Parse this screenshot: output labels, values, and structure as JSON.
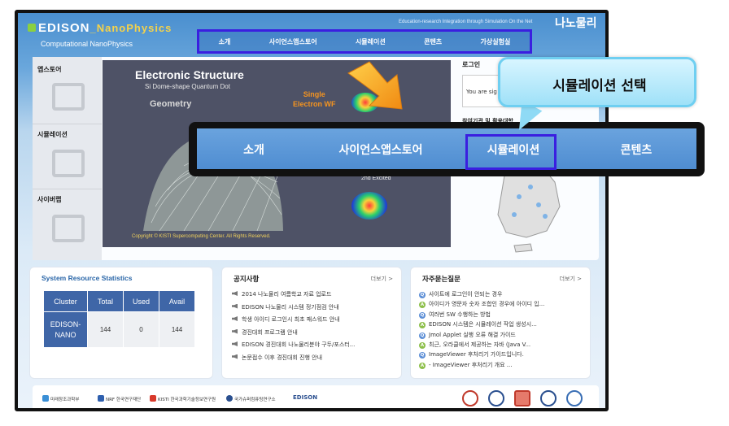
{
  "header": {
    "brand_prefix": "EDISON",
    "brand_suffix": "_NanoPhysics",
    "subtitle": "Computational NanoPhysics",
    "tagline": "Education-research Integration through Simulation On the Net",
    "site_logo": "나노물리"
  },
  "topnav": {
    "items": [
      "소개",
      "사이언스앱스토어",
      "시뮬레이션",
      "콘텐츠",
      "가상실험실"
    ]
  },
  "leftmenu": {
    "items": [
      "앱스토어",
      "시뮬레이션",
      "사이버랩"
    ]
  },
  "hero": {
    "title": "Electronic Structure",
    "subtitle": "Si Dome-shape Quantum Dot",
    "geometry_label": "Geometry",
    "single_label": "Single\nElectron WF",
    "excited_label": "2nd Excited",
    "copyright": "Copyright © KISTI Supercomputing Center. All Rights Reserved."
  },
  "rightpane": {
    "login_title": "로그인",
    "login_text": "You are sig",
    "participants_title": "참여기관 및 활용대학"
  },
  "stats": {
    "title": "System Resource Statistics",
    "columns": [
      "Cluster",
      "Total",
      "Used",
      "Avail"
    ],
    "rows": [
      {
        "cluster": "EDISON-\nNANO",
        "total": "144",
        "used": "0",
        "avail": "144"
      }
    ]
  },
  "notices": {
    "title": "공지사항",
    "more": "더보기 >",
    "items": [
      "2014 나노물리 여름학교 자료 업로드",
      "EDISON 나노물리 시스템 정기점검 안내",
      "학생 아이디 로그인시 최초 패스워드 안내",
      "경진대회 프로그램 안내",
      "EDISON 경진대회 나노물리분야 구두/포스터...",
      "논문접수 이후 경진대회 진행 안내"
    ]
  },
  "faq": {
    "title": "자주묻는질문",
    "more": "더보기 >",
    "items": [
      {
        "q": "사이트에 로그인이 안되는 경우",
        "a": "아이디가 영문자 숫자 조합인 경우에 아이디 입..."
      },
      {
        "q": "여러번 SW 수행하는 방법",
        "a": "EDISON 시스템은 시뮬레이션 작업 생성시..."
      },
      {
        "q": "Jmol Applet 실행 오류 해결 가이드",
        "a": "최근, 오라클에서 제공하는 자바 (Java V..."
      },
      {
        "q": "ImageViewer 후처리기 가이드입니다.",
        "a": "- ImageViewer 후처리기 개요 ..."
      }
    ]
  },
  "footer": {
    "partners": [
      "미래창조과학부",
      "NRF 한국연구재단",
      "KISTI 한국과학기술정보연구원",
      "국가슈퍼컴퓨팅연구소",
      "EDISON"
    ]
  },
  "zoom": {
    "items": [
      "소개",
      "사이언스앱스토어",
      "시뮬레이션",
      "콘텐츠"
    ],
    "callout": "시뮬레이션 선택"
  },
  "colors": {
    "highlight_border": "#3a1fe0",
    "nav_blue": "#4f8dd1",
    "table_header": "#3f66a7",
    "callout_bg": "#9fe1f8"
  }
}
